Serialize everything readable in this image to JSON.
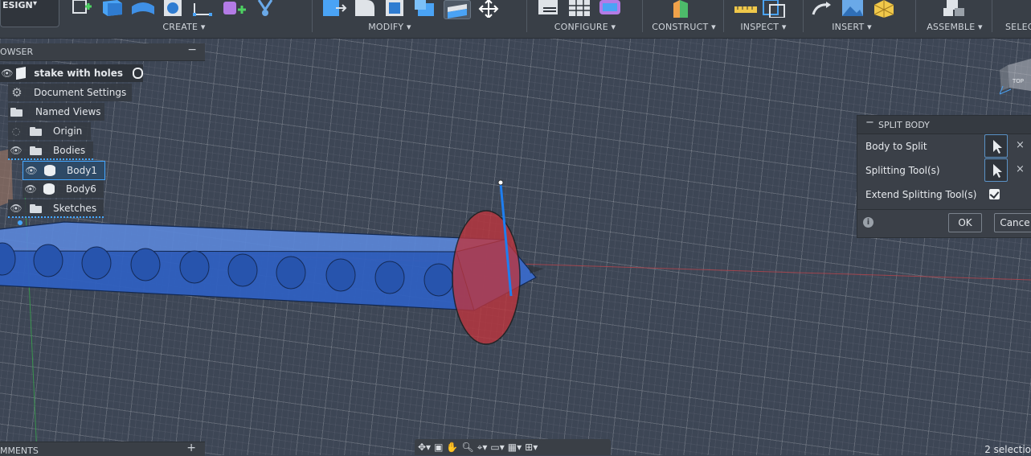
{
  "workspace": {
    "label": "ESIGN"
  },
  "toolbar": {
    "groups": [
      {
        "label": "CREATE ▾"
      },
      {
        "label": "MODIFY ▾"
      },
      {
        "label": "CONFIGURE ▾"
      },
      {
        "label": "CONSTRUCT ▾"
      },
      {
        "label": "INSPECT ▾"
      },
      {
        "label": "INSERT ▾"
      },
      {
        "label": "ASSEMBLE ▾"
      },
      {
        "label": "SELEC"
      }
    ]
  },
  "browser": {
    "title": "OWSER",
    "collapse": "−",
    "root": "stake with holes",
    "items": [
      {
        "label": "Document Settings"
      },
      {
        "label": "Named Views"
      },
      {
        "label": "Origin"
      },
      {
        "label": "Bodies"
      },
      {
        "label": "Body1"
      },
      {
        "label": "Body6"
      },
      {
        "label": "Sketches"
      }
    ]
  },
  "split_body": {
    "title": "SPLIT BODY",
    "collapse": "−",
    "body_to_split_label": "Body to Split",
    "splitting_tools_label": "Splitting Tool(s)",
    "extend_label": "Extend Splitting Tool(s)",
    "extend_checked": true,
    "ok_label": "OK",
    "cancel_label": "Cance",
    "clear_symbol": "×",
    "info_symbol": "i"
  },
  "comments": {
    "title": "MMENTS",
    "add": "+"
  },
  "status": {
    "selection": "2 selectio"
  },
  "viewcube": {
    "face": "TOP"
  },
  "colors": {
    "body": "#3566c4",
    "split_plane": "#c0353d",
    "selection": "#45a7ff",
    "background": "#3d4655"
  }
}
